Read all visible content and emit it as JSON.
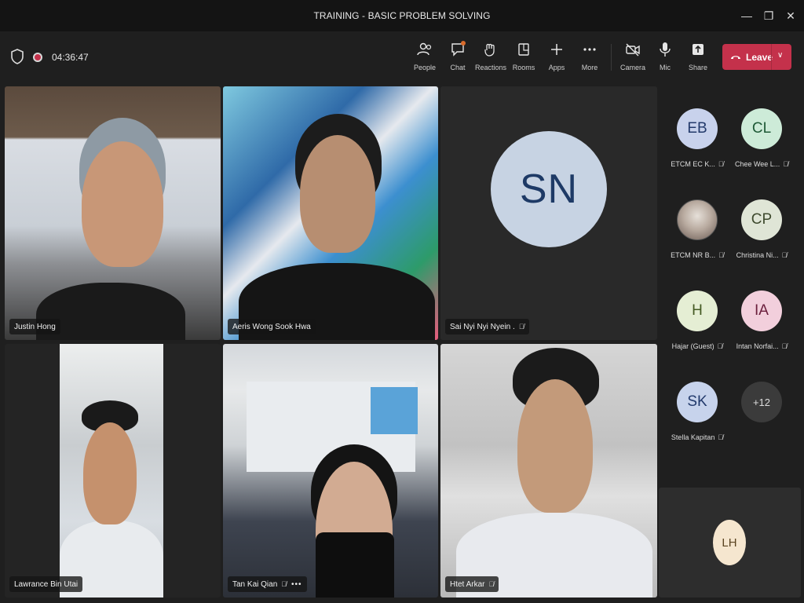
{
  "window": {
    "title": "TRAINING - BASIC PROBLEM SOLVING",
    "minimize_glyph": "—",
    "maximize_glyph": "❐",
    "close_glyph": "✕"
  },
  "toolbar": {
    "timer": "04:36:47",
    "buttons": [
      {
        "label": "People",
        "icon": "people-icon"
      },
      {
        "label": "Chat",
        "icon": "chat-icon"
      },
      {
        "label": "Reactions",
        "icon": "reactions-icon"
      },
      {
        "label": "Rooms",
        "icon": "rooms-icon"
      },
      {
        "label": "Apps",
        "icon": "apps-icon"
      },
      {
        "label": "More",
        "icon": "more-icon"
      },
      {
        "label": "Camera",
        "icon": "camera-off-icon"
      },
      {
        "label": "Mic",
        "icon": "mic-icon"
      },
      {
        "label": "Share",
        "icon": "share-icon"
      }
    ],
    "leave_label": "Leave",
    "leave_color": "#c4314b"
  },
  "stage": {
    "tiles": [
      {
        "name": "Justin Hong",
        "muted": false
      },
      {
        "name": "Aeris Wong Sook Hwa",
        "muted": false
      },
      {
        "name": "Sai Nyi Nyi Nyein .",
        "initials": "SN",
        "muted": true
      },
      {
        "name": "Lawrance Bin Utai",
        "muted": false
      },
      {
        "name": "Tan Kai Qian",
        "muted": true,
        "more": "•••"
      },
      {
        "name": "Htet Arkar",
        "muted": true
      }
    ],
    "self_tile_initials": "LH"
  },
  "roster": [
    {
      "initials": "EB",
      "name": "ETCM EC K...",
      "bg": "#c8d2ec",
      "fg": "#233a6b"
    },
    {
      "initials": "CL",
      "name": "Chee Wee L...",
      "bg": "#cdebd8",
      "fg": "#1f5a37"
    },
    {
      "initials": "",
      "name": "ETCM NR B...",
      "photo": true
    },
    {
      "initials": "CP",
      "name": "Christina Ni...",
      "bg": "#dfe5d6",
      "fg": "#3e4a2e"
    },
    {
      "initials": "H",
      "name": "Hajar (Guest)",
      "bg": "#e5eed4",
      "fg": "#445a23"
    },
    {
      "initials": "IA",
      "name": "Intan Norfai...",
      "bg": "#f2cfdc",
      "fg": "#6b1f3d"
    },
    {
      "initials": "SK",
      "name": "Stella Kapitan",
      "bg": "#c7d3ec",
      "fg": "#223a6c"
    },
    {
      "initials": "+12",
      "name": "",
      "more": true
    }
  ]
}
